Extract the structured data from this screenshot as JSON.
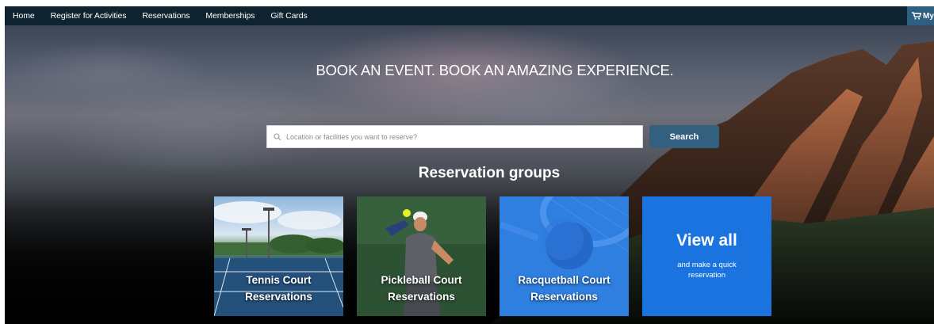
{
  "nav": {
    "items": [
      {
        "label": "Home"
      },
      {
        "label": "Register for Activities"
      },
      {
        "label": "Reservations"
      },
      {
        "label": "Memberships"
      },
      {
        "label": "Gift Cards"
      }
    ],
    "cart_label": "My"
  },
  "hero": {
    "title": "BOOK AN EVENT. BOOK AN AMAZING EXPERIENCE.",
    "search": {
      "placeholder": "Location or facilities you want to reserve?",
      "value": "",
      "button_label": "Search"
    }
  },
  "groups": {
    "title": "Reservation groups",
    "cards": [
      {
        "line1": "Tennis Court",
        "line2": "Reservations"
      },
      {
        "line1": "Pickleball Court",
        "line2": "Reservations"
      },
      {
        "line1": "Racquetball Court",
        "line2": "Reservations"
      }
    ],
    "view_all": {
      "title": "View all",
      "line1": "and make a quick",
      "line2": "reservation"
    }
  },
  "colors": {
    "nav_bg": "#0f2230",
    "search_button": "#34607f",
    "racquetball_card": "#2e7fe0",
    "view_all_card": "#1b73e0"
  },
  "icons": [
    "cart-icon",
    "search-icon"
  ]
}
